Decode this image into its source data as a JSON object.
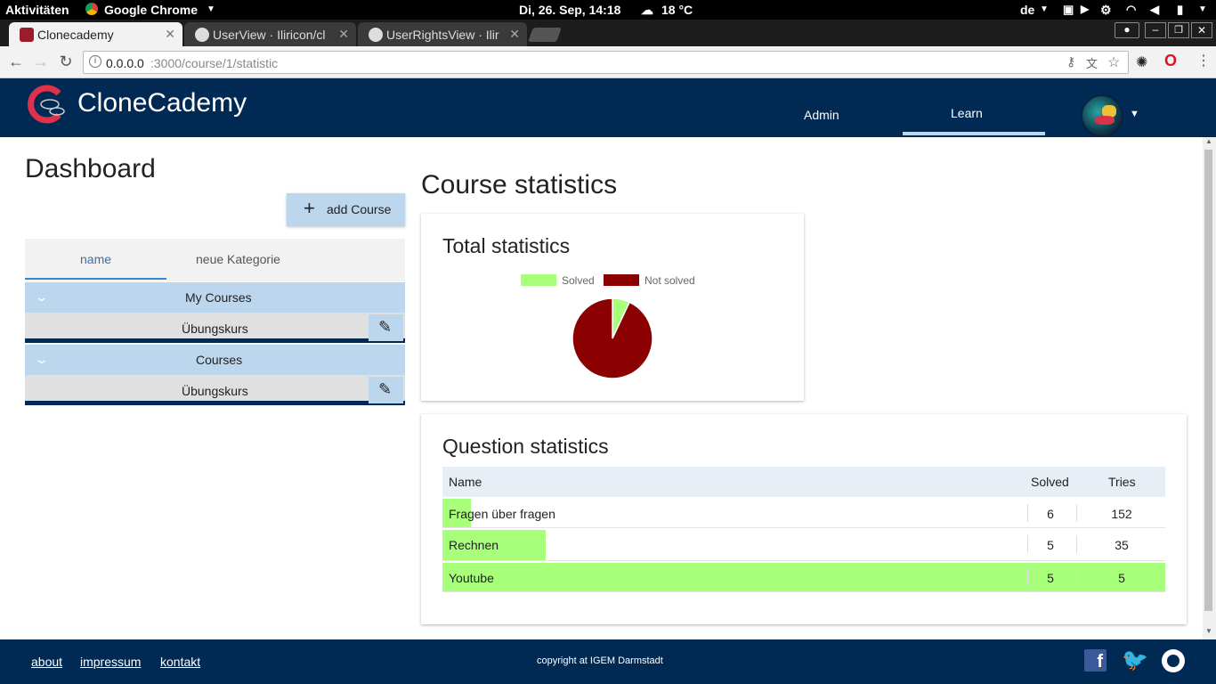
{
  "os": {
    "activities": "Aktivitäten",
    "app_name": "Google Chrome",
    "clock": "Di, 26. Sep, 14:18",
    "weather": "18 °C",
    "lang": "de"
  },
  "browser": {
    "tabs": [
      {
        "title": "Clonecademy",
        "active": true
      },
      {
        "title": "UserView · Iliricon/cl"
      },
      {
        "title": "UserRightsView · Ilir"
      }
    ],
    "url_host": "0.0.0.0",
    "url_path": ":3000/course/1/statistic"
  },
  "app": {
    "brand": "CloneCademy",
    "nav": [
      {
        "label": "Admin"
      },
      {
        "label": "Learn",
        "active": true
      }
    ]
  },
  "dashboard": {
    "title": "Dashboard",
    "add_course_label": "add Course",
    "tabs": [
      {
        "label": "name",
        "active": true
      },
      {
        "label": "neue Kategorie"
      }
    ],
    "groups": [
      {
        "label": "My Courses",
        "items": [
          {
            "label": "Übungskurs"
          }
        ]
      },
      {
        "label": "Courses",
        "items": [
          {
            "label": "Übungskurs"
          }
        ]
      }
    ]
  },
  "stats": {
    "page_title": "Course statistics",
    "total_title": "Total statistics",
    "question_title": "Question statistics",
    "table_headers": {
      "name": "Name",
      "solved": "Solved",
      "tries": "Tries"
    },
    "rows": [
      {
        "name": "Fragen über fragen",
        "solved": "6",
        "tries": "152",
        "fill": 0.039
      },
      {
        "name": "Rechnen",
        "solved": "5",
        "tries": "35",
        "fill": 0.143
      },
      {
        "name": "Youtube",
        "solved": "5",
        "tries": "5",
        "fill": 1.0
      }
    ]
  },
  "chart_data": {
    "type": "pie",
    "categories": [
      "Solved",
      "Not solved"
    ],
    "values": [
      7,
      93
    ],
    "colors": [
      "#a8ff7a",
      "#8b0000"
    ],
    "legend": "top"
  },
  "footer": {
    "links": [
      {
        "label": "about"
      },
      {
        "label": "impressum"
      },
      {
        "label": "kontakt"
      }
    ],
    "copyright": "copyright at IGEM Darmstadt"
  },
  "colors": {
    "header_bg": "#002a54",
    "accent_light": "#bcd6ee",
    "green_fill": "#a8ff7a"
  }
}
